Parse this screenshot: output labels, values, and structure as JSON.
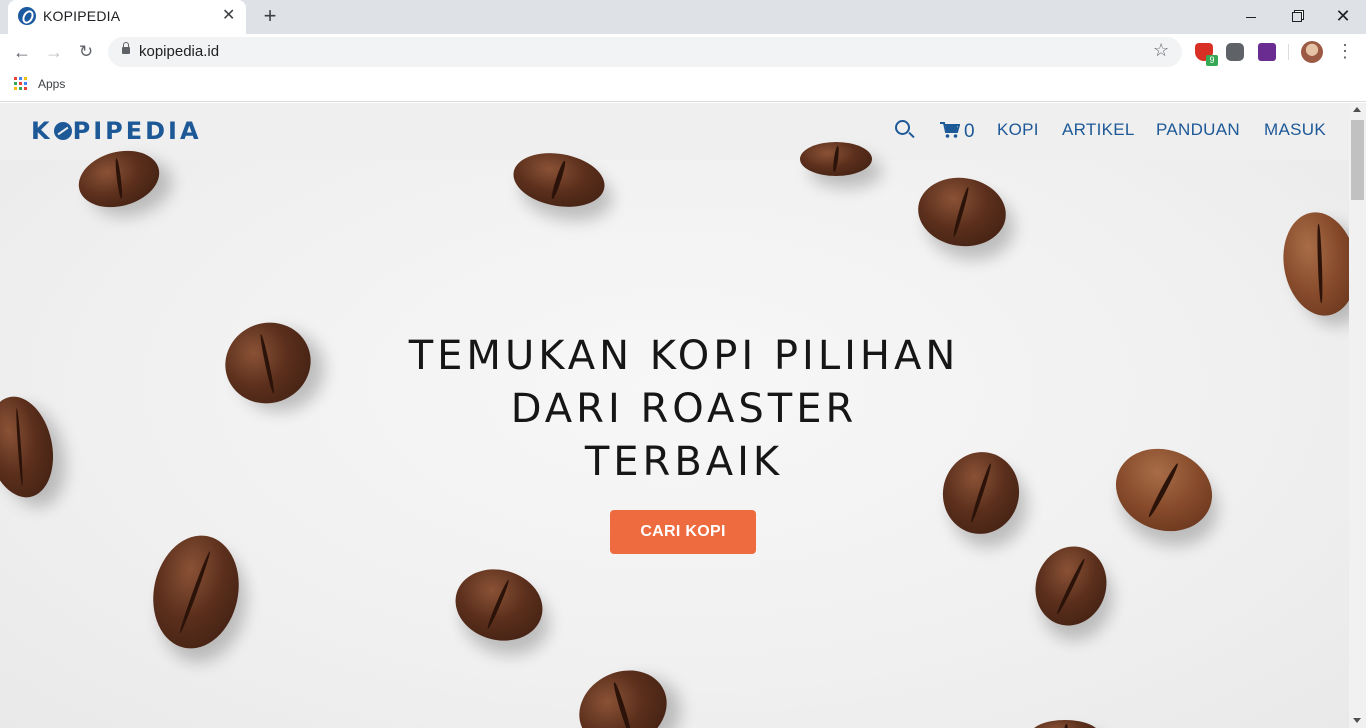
{
  "browser": {
    "tab_title": "KOPIPEDIA",
    "tab_close": "✕",
    "new_tab": "+",
    "url": "kopipedia.id",
    "extension_badge": "9",
    "bookmarks": {
      "apps_label": "Apps"
    }
  },
  "site": {
    "logo": {
      "part1": "K",
      "part2": "PIPEDIA"
    },
    "header": {
      "cart_count": "0",
      "nav": [
        "KOPI",
        "ARTIKEL",
        "PANDUAN",
        "MASUK"
      ]
    },
    "hero": {
      "title_lines": [
        "TEMUKAN KOPI PILIHAN",
        "DARI ROASTER",
        "TERBAIK"
      ],
      "cta_label": "CARI KOPI"
    }
  },
  "colors": {
    "brand_blue": "#1d5897",
    "cta_orange": "#ee6a3f"
  }
}
